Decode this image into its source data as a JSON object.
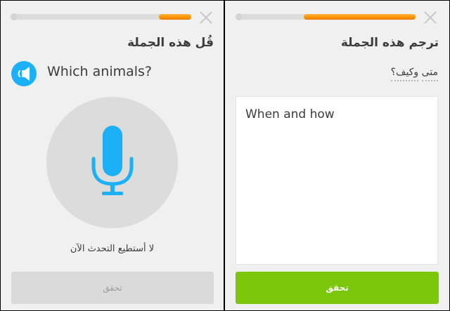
{
  "speak_screen": {
    "title": "قُل هذه الجملة",
    "prompt": "Which animals?",
    "cant_speak": "لا أستطيع التحدث الآن",
    "check_button": "تحقق",
    "progress": 0.18,
    "icons": {
      "speaker": "speaker-icon",
      "microphone": "microphone-icon",
      "close": "close-icon"
    }
  },
  "translate_screen": {
    "title": "ترجم هذه الجملة",
    "source_words": [
      "متى",
      "وكيف؟"
    ],
    "answer": "When and how",
    "check_button": "تحقق",
    "progress": 0.63,
    "icons": {
      "close": "close-icon"
    }
  },
  "colors": {
    "accent_blue": "#1cb0f6",
    "progress_orange": "#ff9600",
    "check_green": "#7ac70c",
    "panel_bg": "#f0f0f0"
  }
}
